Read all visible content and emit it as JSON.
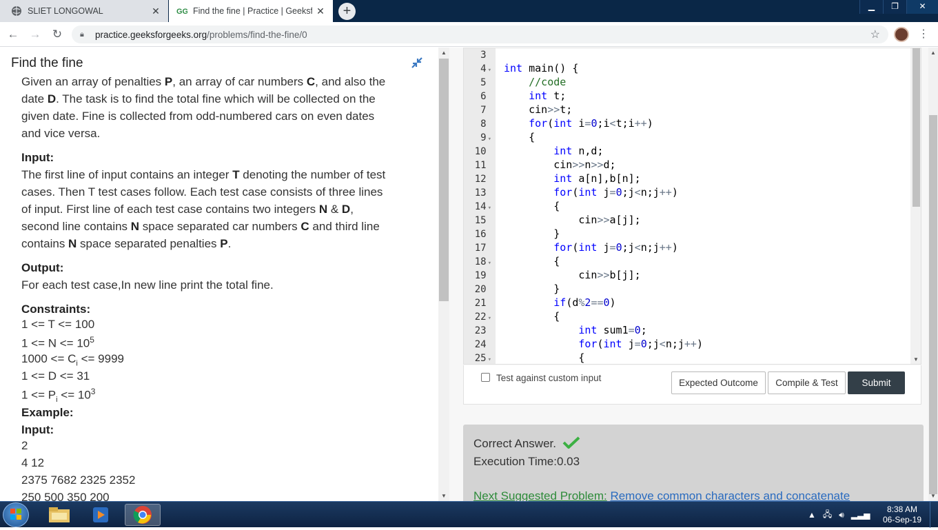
{
  "browser": {
    "tabs": [
      {
        "title": "SLIET LONGOWAL",
        "active": false
      },
      {
        "title": "Find the fine | Practice | Geeksfor",
        "active": true
      }
    ],
    "new_tab": "+",
    "url_host": "practice.geeksforgeeks.org",
    "url_path": "/problems/find-the-fine/0"
  },
  "problem": {
    "title": "Find the fine",
    "description": [
      [
        "Given an array of penalties ",
        "P",
        ", an array of car numbers ",
        "C",
        ", and also the"
      ],
      [
        "date ",
        "D",
        ". The task is to find the total fine which will be collected on the"
      ],
      [
        "given date. Fine is collected from odd-numbered cars on even dates"
      ],
      [
        "and vice versa."
      ]
    ],
    "input_heading": "Input:",
    "input_text": [
      [
        "The first line of input contains an integer ",
        "T",
        " denoting the number of test"
      ],
      [
        "cases. Then T test cases follow. Each test case consists of three lines"
      ],
      [
        "of input. First line of each test case contains two integers ",
        "N",
        " & ",
        "D",
        ","
      ],
      [
        "second line contains ",
        "N",
        " space separated car numbers ",
        "C",
        " and third line"
      ],
      [
        "contains ",
        "N",
        " space separated penalties ",
        "P",
        "."
      ]
    ],
    "output_heading": "Output:",
    "output_text": "For each test case,In new line print the total fine.",
    "constraints_heading": "Constraints:",
    "constraints": [
      {
        "text": "1 <= T <= 100"
      },
      {
        "pre": "1 <= N <= 10",
        "sup": "5"
      },
      {
        "pre": "1000 <= C",
        "sub": "i",
        "post": " <= 9999"
      },
      {
        "text": "1 <= D <= 31"
      },
      {
        "pre": "1 <= P",
        "sub": "i",
        "post": " <= 10",
        "sup": "3"
      }
    ],
    "example_heading": "Example:",
    "example_input_heading": "Input:",
    "example_lines": [
      "2",
      "4 12",
      "2375 7682 2325 2352",
      "250 500 350 200"
    ]
  },
  "editor": {
    "line_numbers": [
      {
        "n": "3",
        "fold": false
      },
      {
        "n": "4",
        "fold": true
      },
      {
        "n": "5",
        "fold": false
      },
      {
        "n": "6",
        "fold": false
      },
      {
        "n": "7",
        "fold": false
      },
      {
        "n": "8",
        "fold": false
      },
      {
        "n": "9",
        "fold": true
      },
      {
        "n": "10",
        "fold": false
      },
      {
        "n": "11",
        "fold": false
      },
      {
        "n": "12",
        "fold": false
      },
      {
        "n": "13",
        "fold": false
      },
      {
        "n": "14",
        "fold": true
      },
      {
        "n": "15",
        "fold": false
      },
      {
        "n": "16",
        "fold": false
      },
      {
        "n": "17",
        "fold": false
      },
      {
        "n": "18",
        "fold": true
      },
      {
        "n": "19",
        "fold": false
      },
      {
        "n": "20",
        "fold": false
      },
      {
        "n": "21",
        "fold": false
      },
      {
        "n": "22",
        "fold": true
      },
      {
        "n": "23",
        "fold": false
      },
      {
        "n": "24",
        "fold": false
      },
      {
        "n": "25",
        "fold": true
      }
    ],
    "code_lines": [
      "",
      "int main() {",
      "    //code",
      "    int t;",
      "    cin>>t;",
      "    for(int i=0;i<t;i++)",
      "    {",
      "        int n,d;",
      "        cin>>n>>d;",
      "        int a[n],b[n];",
      "        for(int j=0;j<n;j++)",
      "        {",
      "            cin>>a[j];",
      "        }",
      "        for(int j=0;j<n;j++)",
      "        {",
      "            cin>>b[j];",
      "        }",
      "        if(d%2==0)",
      "        {",
      "            int sum1=0;",
      "            for(int j=0;j<n;j++)",
      "            {"
    ]
  },
  "actions": {
    "custom_input_label": "Test against custom input",
    "expected_outcome": "Expected Outcome",
    "compile_test": "Compile & Test",
    "submit": "Submit"
  },
  "result": {
    "status": "Correct Answer.",
    "execution_time": "Execution Time:0.03",
    "next_label": "Next Suggested Problem:",
    "next_link": "Remove common characters and concatenate"
  },
  "taskbar": {
    "time": "8:38 AM",
    "date": "06-Sep-19"
  },
  "colors": {
    "keyword": "#0000ff",
    "comment": "#236e25",
    "number": "#0000cd",
    "submit_bg": "#333f48",
    "result_bg": "#d3d3d3",
    "link": "#2a6bbf",
    "next_label": "#2e8b3a"
  }
}
